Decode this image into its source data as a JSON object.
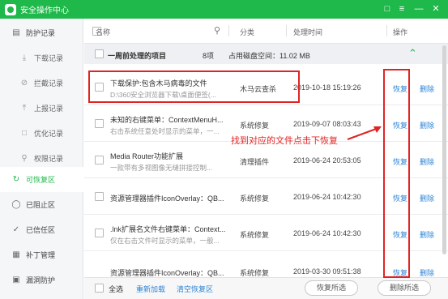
{
  "app": {
    "title": "安全操作中心"
  },
  "sidebar": {
    "items": [
      {
        "label": "防护记录",
        "icon": "clipboard-icon"
      },
      {
        "label": "下载记录",
        "icon": "download-icon"
      },
      {
        "label": "拦截记录",
        "icon": "block-icon"
      },
      {
        "label": "上报记录",
        "icon": "upload-icon"
      },
      {
        "label": "优化记录",
        "icon": "optimize-icon"
      },
      {
        "label": "权限记录",
        "icon": "key-icon"
      },
      {
        "label": "可恢复区",
        "icon": "restore-icon"
      },
      {
        "label": "已阻止区",
        "icon": "shield-block-icon"
      },
      {
        "label": "已信任区",
        "icon": "shield-trust-icon"
      },
      {
        "label": "补丁管理",
        "icon": "patch-icon"
      },
      {
        "label": "漏洞防护",
        "icon": "vuln-icon"
      }
    ]
  },
  "columns": {
    "name": "名称",
    "category": "分类",
    "time": "处理时间",
    "action": "操作"
  },
  "group": {
    "title": "一周前处理的项目",
    "count": "8项",
    "disk": "占用磁盘空间：11.02 MB"
  },
  "rows": [
    {
      "title": "下载保护:包含木马病毒的文件",
      "sub": "D:\\360安全浏览器下载\\桌面便签(...",
      "category": "木马云查杀",
      "time": "2019-10-18 15:19:26",
      "restore": "恢复",
      "delete": "删除"
    },
    {
      "title": "未知的右键菜单：ContextMenuH...",
      "sub": "右击系统任意处时显示的菜单，一...",
      "category": "系统修复",
      "time": "2019-09-07 08:03:43",
      "restore": "恢复",
      "delete": "删除"
    },
    {
      "title": "Media Router功能扩展",
      "sub": "一款带有多视图像无缝拼接控制...",
      "category": "清理插件",
      "time": "2019-06-24 20:53:05",
      "restore": "恢复",
      "delete": "删除"
    },
    {
      "title": "资源管理器插件IconOverlay：QB...",
      "sub": "",
      "category": "系统修复",
      "time": "2019-06-24 10:42:30",
      "restore": "恢复",
      "delete": "删除"
    },
    {
      "title": ".lnk扩展名文件右键菜单：Context...",
      "sub": "仅在右击文件时显示的菜单，一般...",
      "category": "系统修复",
      "time": "2019-06-24 10:42:30",
      "restore": "恢复",
      "delete": "删除"
    },
    {
      "title": "资源管理器插件IconOverlay：QB...",
      "sub": "",
      "category": "系统修复",
      "time": "2019-03-30 09:51:38",
      "restore": "恢复",
      "delete": "删除"
    }
  ],
  "footer": {
    "select_all": "全选",
    "reload": "重新加载",
    "clear": "清空恢复区",
    "restore_selected": "恢复所选",
    "delete_selected": "删除所选"
  },
  "annotation": {
    "text": "找到对应的文件点击下恢复"
  },
  "colors": {
    "brand": "#1fb84a",
    "link": "#2a83d6",
    "annotation": "#e02424"
  }
}
